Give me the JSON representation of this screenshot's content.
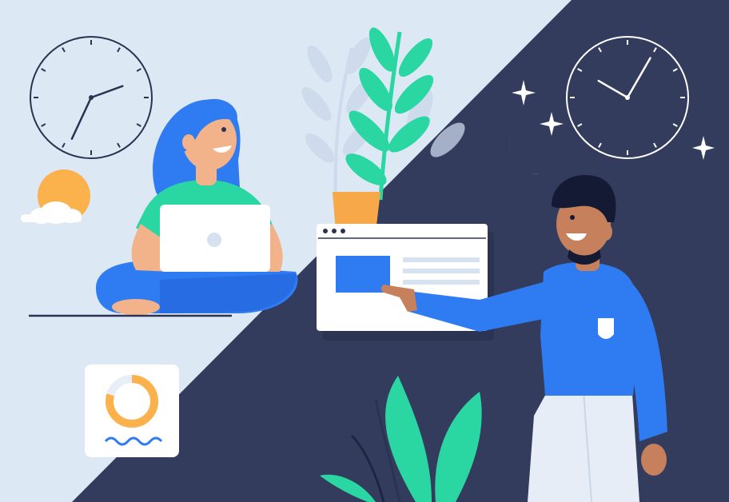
{
  "palette": {
    "day_bg": "#dce8f4",
    "night_bg": "#343c5e",
    "navy": "#2c3352",
    "white": "#ffffff",
    "blue": "#2f7bf2",
    "blue_dark": "#2563d9",
    "teal": "#2ad6a1",
    "skin_light": "#f3b38a",
    "skin_dark": "#c7805c",
    "orange": "#fbb24d",
    "pale_blue": "#c9d7ea",
    "light_gray": "#e8eef6",
    "pot_orange": "#f7a94a"
  },
  "scene": {
    "day_icons": [
      "sun-icon",
      "cloud-icon",
      "clock-icon",
      "plant-icon",
      "laptop-icon",
      "donut-chart-icon",
      "wave-icon"
    ],
    "night_icons": [
      "moon-icon",
      "star-icon",
      "clock-icon",
      "browser-window-icon",
      "plant-icon"
    ]
  }
}
